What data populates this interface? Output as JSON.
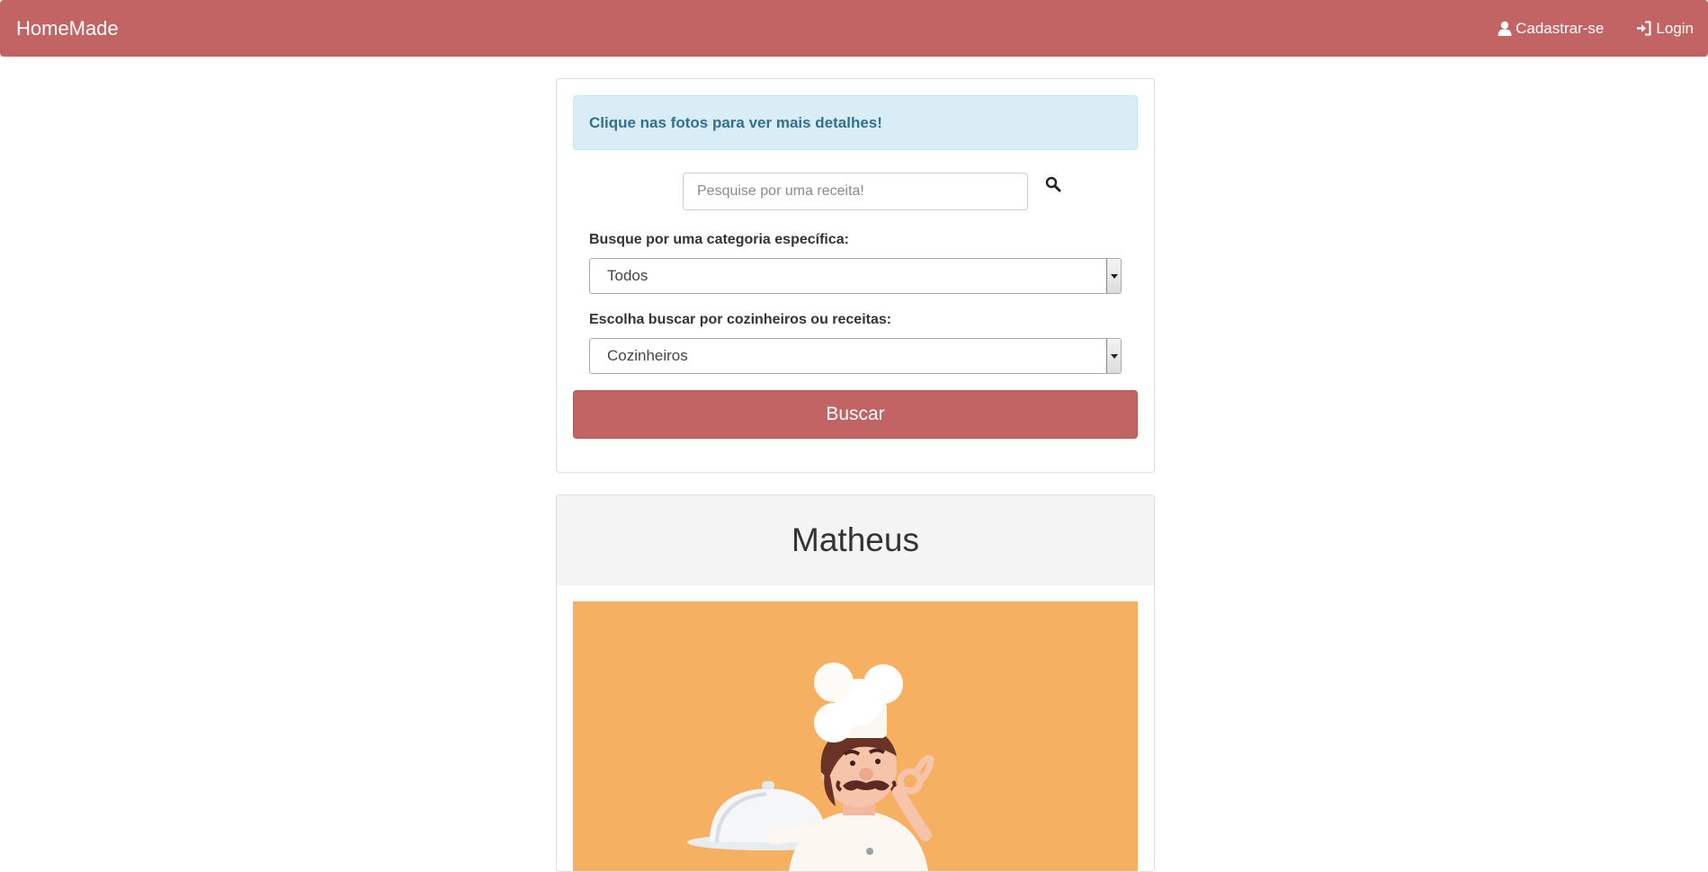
{
  "navbar": {
    "brand": "HomeMade",
    "signup_label": "Cadastrar-se",
    "login_label": "Login",
    "color": "#c26463"
  },
  "search_panel": {
    "alert_text": "Clique nas fotos para ver mais detalhes!",
    "search_placeholder": "Pesquise por uma receita!",
    "search_icon": "search-icon",
    "category_label": "Busque por uma categoria específica:",
    "category_selected": "Todos",
    "type_label": "Escolha buscar por cozinheiros ou receitas:",
    "type_selected": "Cozinheiros",
    "submit_label": "Buscar"
  },
  "results": [
    {
      "name": "Matheus",
      "image": "chef-illustration",
      "image_bg": "#f6b062"
    }
  ]
}
